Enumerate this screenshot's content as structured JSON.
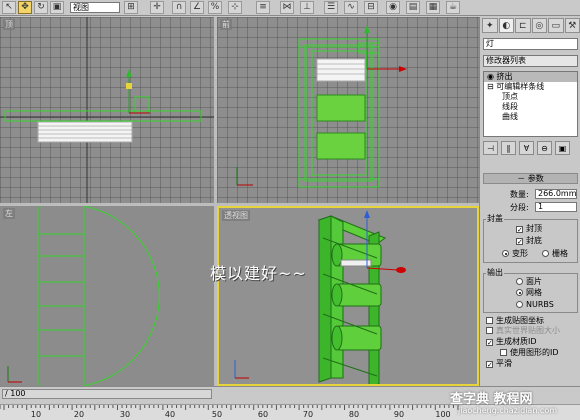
{
  "toolbar": {
    "viewport_selector": "视图"
  },
  "viewports": {
    "top_label": "顶",
    "front_label": "前",
    "left_label": "左",
    "persp_label": "透视图"
  },
  "overlay_caption": "模以建好~~",
  "panel": {
    "object_name": "灯",
    "modifier_list_label": "修改器列表",
    "stack_items": [
      "挤出",
      "可编辑样条线",
      "顶点",
      "线段",
      "曲线"
    ],
    "params_title": "参数",
    "amount_label": "数量:",
    "amount_value": "266.0mm",
    "segments_label": "分段:",
    "segments_value": "1",
    "capping_label": "封盖",
    "cap_start_label": "封顶",
    "cap_end_label": "封底",
    "morph_label": "变形",
    "grid_label": "栅格",
    "output_label": "输出",
    "patch_label": "面片",
    "mesh_label": "网格",
    "nurbs_label": "NURBS",
    "gen_mapping_label": "生成贴图坐标",
    "real_world_label": "真实世界贴图大小",
    "gen_material_label": "生成材质ID",
    "use_shape_ids_label": "使用图形的ID",
    "smooth_label": "平滑"
  },
  "timebar": {
    "frame_indicator": "/ 100",
    "ruler_ticks": [
      "10",
      "20",
      "30",
      "40",
      "50",
      "60",
      "70",
      "80",
      "90",
      "100"
    ]
  },
  "watermark": {
    "site": "查字典 教程网",
    "url": "jiaocheng.chazidian.com"
  },
  "colors": {
    "object_green": "#39d62e",
    "active_border": "#e6d43a",
    "viewport_bg": "#8e8e8e"
  }
}
